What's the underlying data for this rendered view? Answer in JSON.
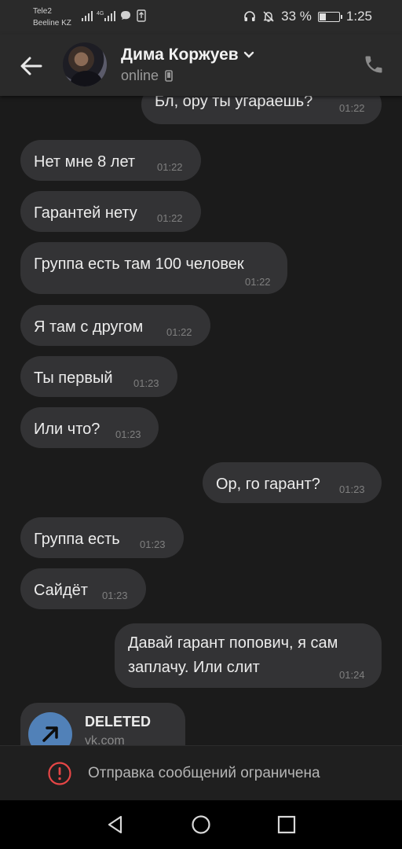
{
  "status_bar": {
    "carrier1": "Tele2",
    "carrier2": "Beeline KZ",
    "network": "4G",
    "battery": "33 %",
    "battery_level": 0.33,
    "time": "1:25"
  },
  "header": {
    "contact_name": "Дима Коржуев",
    "status": "online"
  },
  "messages": [
    {
      "side": "out",
      "text": "Бл, ору ты угараешь?",
      "time": "01:22"
    },
    {
      "side": "in",
      "text": "Нет мне 8 лет",
      "time": "01:22"
    },
    {
      "side": "in",
      "text": "Гарантей нету",
      "time": "01:22"
    },
    {
      "side": "in",
      "text": "Группа есть там 100 человек",
      "time": "01:22"
    },
    {
      "side": "in",
      "text": "Я там с другом",
      "time": "01:22"
    },
    {
      "side": "in",
      "text": "Ты первый",
      "time": "01:23"
    },
    {
      "side": "in",
      "text": "Или что?",
      "time": "01:23"
    },
    {
      "side": "out",
      "text": "Ор, го гарант?",
      "time": "01:23"
    },
    {
      "side": "in",
      "text": "Группа есть",
      "time": "01:23"
    },
    {
      "side": "in",
      "text": "Сайдёт",
      "time": "01:23"
    },
    {
      "side": "out",
      "text_line1": "Давай гарант попович, я сам",
      "text_line2": "заплачу. Или слит",
      "time": "01:24"
    }
  ],
  "link_card": {
    "title": "DELETED",
    "subtitle": "vk.com"
  },
  "restriction": {
    "text": "Отправка сообщений ограничена"
  },
  "colors": {
    "background": "#1b1b1b",
    "bubble": "#333335",
    "header": "#2a2a2a",
    "accent_blue": "#5181b8",
    "warning_red": "#e64646"
  }
}
